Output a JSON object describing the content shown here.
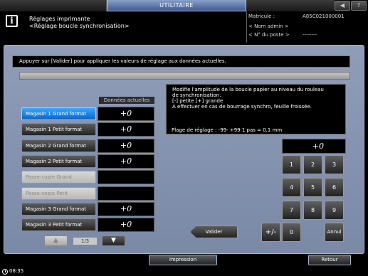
{
  "top_bar": {
    "tab_label": "UTILITAIRE",
    "icons": [
      "speaker-icon",
      "help-icon"
    ]
  },
  "header": {
    "icon": "info-icon",
    "title_line1": "Réglages imprimante",
    "title_line2": "<Réglage boucle synchronisation>",
    "matricule_label": "Matricule  :",
    "matricule_value": "A85C021000001",
    "admin_label": "< Nom admin >",
    "poste_label": "< N° du poste >",
    "poste_value": "--------"
  },
  "instruction": "Appuyer sur [Valider] pour appliquer les valeurs de réglage aux données actuelles.",
  "column_header": "Données actuelles",
  "trays": [
    {
      "label": "Magasin 1 Grand format",
      "value": "+0",
      "state": "selected"
    },
    {
      "label": "Magasin 1 Petit format",
      "value": "+0",
      "state": "normal"
    },
    {
      "label": "Magasin 2 Grand format",
      "value": "+0",
      "state": "normal"
    },
    {
      "label": "Magasin 2 Petit format",
      "value": "+0",
      "state": "normal"
    },
    {
      "label": "Passe-copie Grand",
      "value": "",
      "state": "disabled"
    },
    {
      "label": "Passe-copie Petit",
      "value": "",
      "state": "disabled"
    },
    {
      "label": "Magasin 3 Grand format",
      "value": "+0",
      "state": "normal"
    },
    {
      "label": "Magasin 3 Petit format",
      "value": "+0",
      "state": "normal"
    }
  ],
  "pager": {
    "indicator": "1/3",
    "up_icon": "▲",
    "down_icon": "▼"
  },
  "description": {
    "lines": [
      "Modifie l'amplitude de la boucle papier au niveau du rouleau",
      "de synchronisation.",
      "[-] petite [+] grande",
      "A effectuer en cas de bourrage synchro, feuille froissée."
    ],
    "range": "Plage de réglage : -99- +99 1 pas = 0,1 mm"
  },
  "current_value": "+0",
  "keypad": {
    "keys": [
      "1",
      "2",
      "3",
      "4",
      "5",
      "6",
      "7",
      "8",
      "9"
    ],
    "sign": "+/-",
    "zero": "0",
    "clear": "Annul"
  },
  "valider_label": "Valider",
  "bottom": {
    "print_label": "Impression",
    "back_label": "Retour",
    "time": "08:35"
  },
  "colors": {
    "accent_blue": "#1a7fe0",
    "panel": "#8594b0",
    "tab": "#5a74a6"
  }
}
